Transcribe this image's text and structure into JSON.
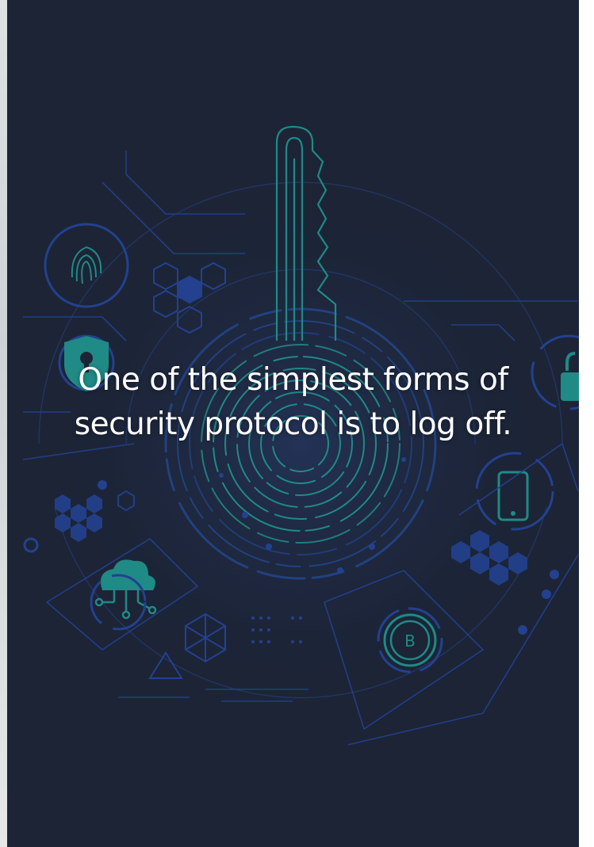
{
  "quote": {
    "text": "One of the simplest forms of security protocol is to log off."
  },
  "colors": {
    "background": "#1c2436",
    "accent_teal": "#1f8a86",
    "accent_blue": "#23418f",
    "text": "#ffffff"
  },
  "background_art": {
    "central_icon": "key-icon",
    "decorative_icons": [
      "fingerprint-icon",
      "shield-lock-icon",
      "cloud-network-icon",
      "smartphone-icon",
      "bitcoin-icon",
      "padlock-icon",
      "hexagon-cluster-icon"
    ]
  }
}
